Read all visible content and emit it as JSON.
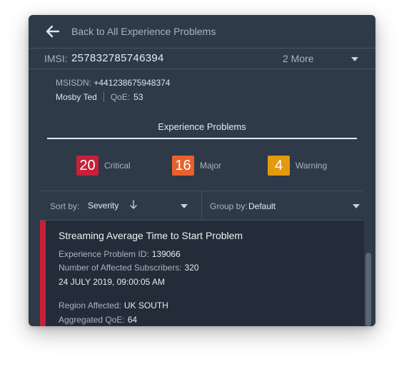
{
  "header": {
    "back_label": "Back to All Experience Problems"
  },
  "imsi": {
    "label": "IMSI:",
    "value": "257832785746394",
    "more": "2 More"
  },
  "subscriber": {
    "msisdn_label": "MSISDN:",
    "msisdn_value": "+441238675948374",
    "name": "Mosby Ted",
    "qoe_label": "QoE:",
    "qoe_value": "53"
  },
  "section_title": "Experience Problems",
  "counts": [
    {
      "value": "20",
      "label": "Critical",
      "color": "#c8203a"
    },
    {
      "value": "16",
      "label": "Major",
      "color": "#e8612c"
    },
    {
      "value": "4",
      "label": "Warning",
      "color": "#e39a0f"
    }
  ],
  "sort": {
    "label": "Sort by:",
    "value": "Severity",
    "group_label": "Group by:",
    "group_value": "Default"
  },
  "problem_card": {
    "severity_color": "#c8203a",
    "title": "Streaming Average Time to Start Problem",
    "id_label": "Experience Problem ID:",
    "id_value": "139066",
    "affected_label": "Number of Affected Subscribers:",
    "affected_value": "320",
    "date": "24 JULY 2019, 09:00:05 AM",
    "region_label": "Region Affected:",
    "region_value": "UK SOUTH",
    "qoe_label": "Aggregated QoE:",
    "qoe_value": "64"
  },
  "icons": {
    "back": "arrow-left-icon",
    "dropdown": "chevron-down-icon",
    "sort_direction": "arrow-down-icon"
  }
}
